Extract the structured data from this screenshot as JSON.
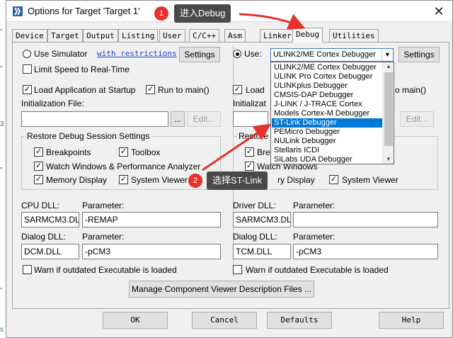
{
  "window": {
    "title": "Options for Target 'Target 1'",
    "close_glyph": "✕"
  },
  "tabs": [
    "Device",
    "Target",
    "Output",
    "Listing",
    "User",
    "C/C++",
    "Asm",
    "Linker",
    "Debug",
    "Utilities"
  ],
  "left": {
    "use_simulator_label": "Use Simulator",
    "with_restrictions": "with restrictions",
    "settings_label": "Settings",
    "limit_speed_label": "Limit Speed to Real-Time",
    "load_app_label": "Load Application at Startup",
    "run_to_main_label": "Run to main()",
    "init_file_label": "Initialization File:",
    "browse_label": "...",
    "edit_label": "Edit...",
    "restore_group_title": "Restore Debug Session Settings",
    "breakpoints_label": "Breakpoints",
    "toolbox_label": "Toolbox",
    "watch_windows_label": "Watch Windows & Performance Analyzer",
    "memory_display_label": "Memory Display",
    "system_viewer_label": "System Viewer",
    "cpu_dll_label": "CPU DLL:",
    "cpu_param_label": "Parameter:",
    "cpu_dll_value": "SARMCM3.DLL",
    "cpu_param_value": "-REMAP",
    "dialog_dll_label": "Dialog DLL:",
    "dialog_param_label": "Parameter:",
    "dialog_dll_value": "DCM.DLL",
    "dialog_param_value": "-pCM3",
    "warn_label": "Warn if outdated Executable is loaded"
  },
  "right": {
    "use_label": "Use:",
    "debugger_selected": "ULINK2/ME Cortex Debugger",
    "settings_label": "Settings",
    "load_label": "Load",
    "run_to_main_partial": "o main()",
    "init_partial": "Initializat",
    "edit_label": "Edit...",
    "restore_partial": "Restore",
    "breakpoints_partial": "Brea",
    "watch_windows_label": "Watch Windows",
    "memory_display_label": "ry Display",
    "system_viewer_label": "System Viewer",
    "driver_dll_label": "Driver DLL:",
    "driver_param_label": "Parameter:",
    "driver_dll_value": "SARMCM3.DLL",
    "driver_param_value": "",
    "dialog_dll_label": "Dialog DLL:",
    "dialog_param_label": "Parameter:",
    "dialog_dll_value": "TCM.DLL",
    "dialog_param_value": "-pCM3",
    "warn_label": "Warn if outdated Executable is loaded"
  },
  "dropdown_options": [
    "ULINK2/ME Cortex Debugger",
    "ULINK Pro Cortex Debugger",
    "ULINKplus Debugger",
    "CMSIS-DAP Debugger",
    "J-LINK / J-TRACE Cortex",
    "Models Cortex-M Debugger",
    "ST-Link Debugger",
    "PEMicro Debugger",
    "NULink Debugger",
    "Stellaris ICDI",
    "SiLabs UDA Debugger"
  ],
  "dropdown_selected_index": 6,
  "manage_button_label": "Manage Component Viewer Description Files ...",
  "bottom_buttons": {
    "ok": "OK",
    "cancel": "Cancel",
    "defaults": "Defaults",
    "help": "Help"
  },
  "annotations": {
    "step1_badge": "1",
    "step1_text": "进入Debug",
    "step2_badge": "2",
    "step2_text": "选择ST-Link"
  },
  "edge_fragments": [
    "\"",
    "\"",
    "3",
    "\"",
    "\"",
    "s"
  ],
  "colors": {
    "accent_arrow": "#e5322d",
    "selection": "#0078d7",
    "callout_bg": "#4a4a4a"
  }
}
